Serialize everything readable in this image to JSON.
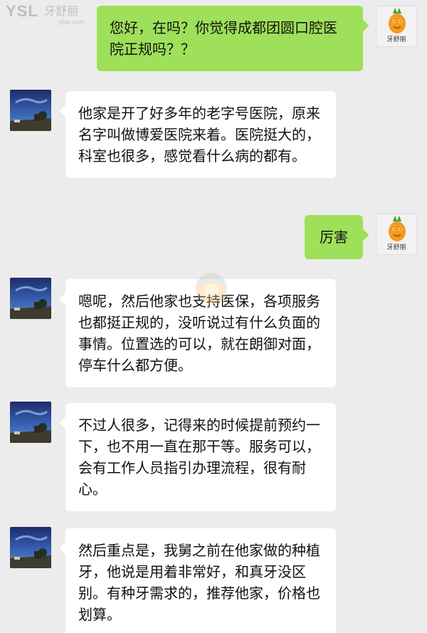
{
  "watermark": {
    "logo": "YSL",
    "brand": "牙舒丽",
    "url": "yslw.com"
  },
  "contacts": {
    "me_label": "牙舒丽"
  },
  "messages": [
    {
      "side": "out",
      "text": "您好，在吗？你觉得成都团圆口腔医院正规吗？？"
    },
    {
      "side": "in",
      "text": "他家是开了好多年的老字号医院，原来名字叫做博爱医院来着。医院挺大的，科室也很多，感觉看什么病的都有。"
    },
    {
      "side": "out",
      "text": "厉害"
    },
    {
      "side": "in",
      "text": "嗯呢，然后他家也支持医保，各项服务也都挺正规的，没听说过有什么负面的事情。位置选的可以，就在朗御对面，停车什么都方便。"
    },
    {
      "side": "in",
      "text": "不过人很多，记得来的时候提前预约一下，也不用一直在那干等。服务可以，会有工作人员指引办理流程，很有耐心。"
    },
    {
      "side": "in",
      "text": "然后重点是，我舅之前在他家做的种植牙，他说是用着非常好，和真牙没区别。有种牙需求的，推荐他家，价格也划算。"
    }
  ]
}
